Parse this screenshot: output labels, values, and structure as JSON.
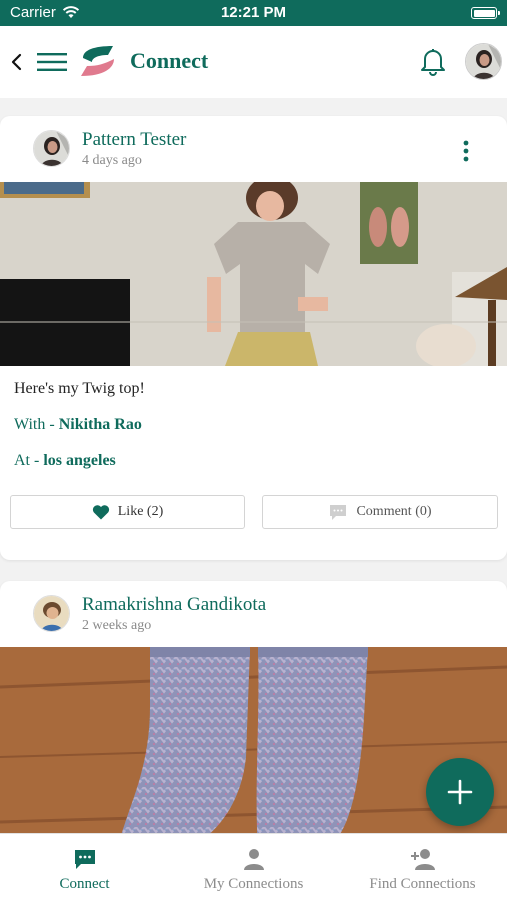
{
  "status_bar": {
    "carrier": "Carrier",
    "time": "12:21 PM"
  },
  "header": {
    "title": "Connect"
  },
  "posts": [
    {
      "author": "Pattern Tester",
      "time": "4 days ago",
      "caption": "Here's my Twig top!",
      "with_label": "With -",
      "with_value": "Nikitha Rao",
      "at_label": "At -",
      "at_value": "los angeles",
      "like_label": "Like (2)",
      "comment_label": "Comment (0)"
    },
    {
      "author": "Ramakrishna Gandikota",
      "time": "2 weeks ago"
    }
  ],
  "bottom_nav": {
    "items": [
      {
        "label": "Connect"
      },
      {
        "label": "My Connections"
      },
      {
        "label": "Find Connections"
      }
    ]
  },
  "colors": {
    "brand": "#0f6b5c",
    "inactive": "#8c8c8c",
    "logo_pink": "#e07a8e"
  }
}
